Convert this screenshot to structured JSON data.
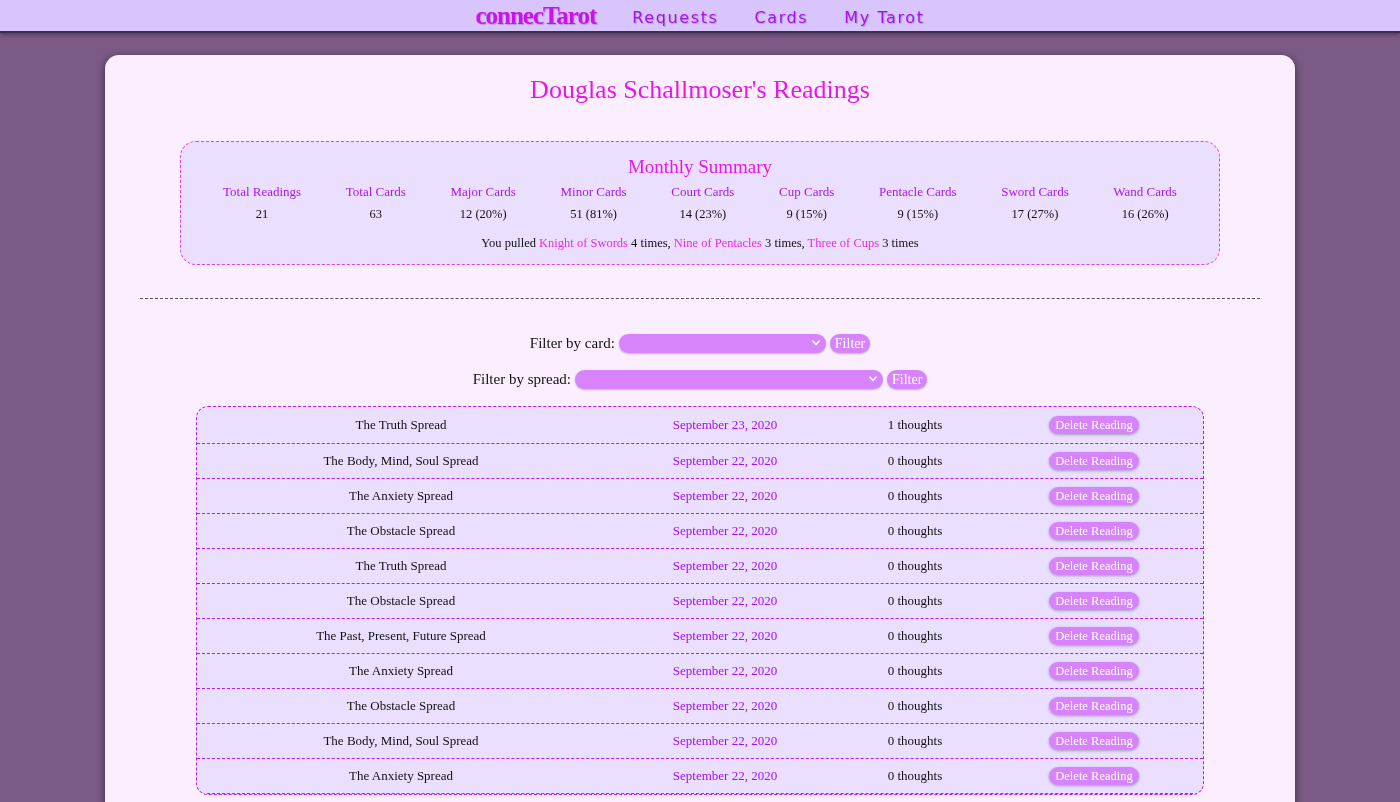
{
  "nav": {
    "logo": "connecTarot",
    "links": [
      "Requests",
      "Cards",
      "My Tarot"
    ]
  },
  "page_title": "Douglas Schallmoser's Readings",
  "summary": {
    "title": "Monthly Summary",
    "stats": [
      {
        "label": "Total Readings",
        "value": "21"
      },
      {
        "label": "Total Cards",
        "value": "63"
      },
      {
        "label": "Major Cards",
        "value": "12 (20%)"
      },
      {
        "label": "Minor Cards",
        "value": "51 (81%)"
      },
      {
        "label": "Court Cards",
        "value": "14 (23%)"
      },
      {
        "label": "Cup Cards",
        "value": "9 (15%)"
      },
      {
        "label": "Pentacle Cards",
        "value": "9 (15%)"
      },
      {
        "label": "Sword Cards",
        "value": "17 (27%)"
      },
      {
        "label": "Wand Cards",
        "value": "16 (26%)"
      }
    ],
    "sentence": [
      {
        "kind": "text",
        "text": "You pulled "
      },
      {
        "kind": "card",
        "text": "Knight of Swords"
      },
      {
        "kind": "text",
        "text": " 4 times, "
      },
      {
        "kind": "card",
        "text": "Nine of Pentacles"
      },
      {
        "kind": "text",
        "text": " 3 times, "
      },
      {
        "kind": "card",
        "text": "Three of Cups"
      },
      {
        "kind": "text",
        "text": " 3 times"
      }
    ]
  },
  "filters": [
    {
      "kind": "card",
      "label": "Filter by card:",
      "button": "Filter"
    },
    {
      "kind": "spread",
      "label": "Filter by spread:",
      "button": "Filter"
    }
  ],
  "readings": [
    {
      "spread": "The Truth Spread",
      "date": "September 23, 2020",
      "thoughts": "1 thoughts",
      "button": "Delete Reading"
    },
    {
      "spread": "The Body, Mind, Soul Spread",
      "date": "September 22, 2020",
      "thoughts": "0 thoughts",
      "button": "Delete Reading"
    },
    {
      "spread": "The Anxiety Spread",
      "date": "September 22, 2020",
      "thoughts": "0 thoughts",
      "button": "Delete Reading"
    },
    {
      "spread": "The Obstacle Spread",
      "date": "September 22, 2020",
      "thoughts": "0 thoughts",
      "button": "Delete Reading"
    },
    {
      "spread": "The Truth Spread",
      "date": "September 22, 2020",
      "thoughts": "0 thoughts",
      "button": "Delete Reading"
    },
    {
      "spread": "The Obstacle Spread",
      "date": "September 22, 2020",
      "thoughts": "0 thoughts",
      "button": "Delete Reading"
    },
    {
      "spread": "The Past, Present, Future Spread",
      "date": "September 22, 2020",
      "thoughts": "0 thoughts",
      "button": "Delete Reading"
    },
    {
      "spread": "The Anxiety Spread",
      "date": "September 22, 2020",
      "thoughts": "0 thoughts",
      "button": "Delete Reading"
    },
    {
      "spread": "The Obstacle Spread",
      "date": "September 22, 2020",
      "thoughts": "0 thoughts",
      "button": "Delete Reading"
    },
    {
      "spread": "The Body, Mind, Soul Spread",
      "date": "September 22, 2020",
      "thoughts": "0 thoughts",
      "button": "Delete Reading"
    },
    {
      "spread": "The Anxiety Spread",
      "date": "September 22, 2020",
      "thoughts": "0 thoughts",
      "button": "Delete Reading"
    }
  ]
}
